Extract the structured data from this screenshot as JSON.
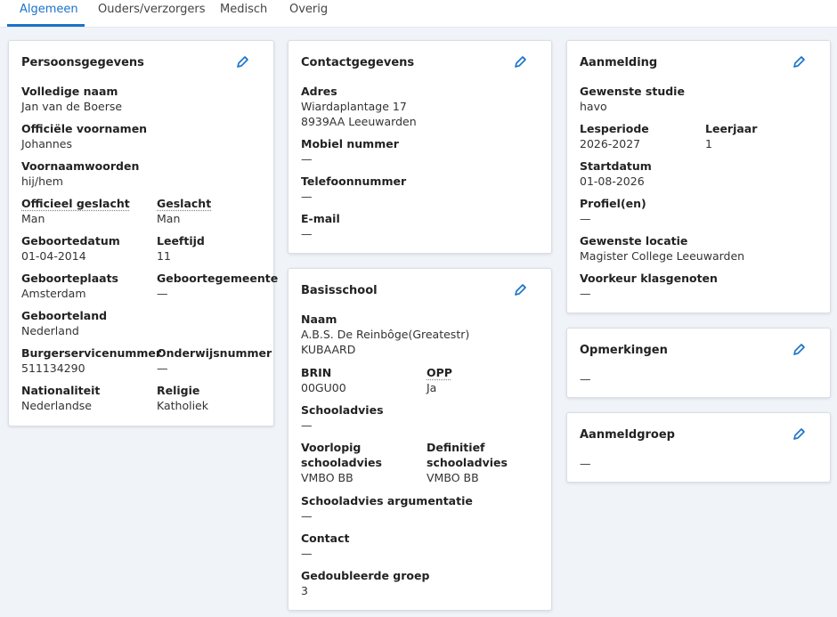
{
  "tabs": [
    "Algemeen",
    "Ouders/verzorgers",
    "Medisch",
    "Overig"
  ],
  "persoon": {
    "title": "Persoonsgegevens",
    "volledige_naam": {
      "label": "Volledige naam",
      "value": "Jan van de Boerse"
    },
    "officiele_voornamen": {
      "label": "Officiële voornamen",
      "value": "Johannes"
    },
    "voornaamwoorden": {
      "label": "Voornaamwoorden",
      "value": "hij/hem"
    },
    "officieel_geslacht": {
      "label": "Officieel geslacht",
      "value": "Man"
    },
    "geslacht": {
      "label": "Geslacht",
      "value": "Man"
    },
    "geboortedatum": {
      "label": "Geboortedatum",
      "value": "01-04-2014"
    },
    "leeftijd": {
      "label": "Leeftijd",
      "value": "11"
    },
    "geboorteplaats": {
      "label": "Geboorteplaats",
      "value": "Amsterdam"
    },
    "geboortegemeente": {
      "label": "Geboortegemeente",
      "value": "—"
    },
    "geboorteland": {
      "label": "Geboorteland",
      "value": "Nederland"
    },
    "bsn": {
      "label": "Burgerservicenummer",
      "value": "511134290"
    },
    "onderwijsnummer": {
      "label": "Onderwijsnummer",
      "value": "—"
    },
    "nationaliteit": {
      "label": "Nationaliteit",
      "value": "Nederlandse"
    },
    "religie": {
      "label": "Religie",
      "value": "Katholiek"
    }
  },
  "contact": {
    "title": "Contactgegevens",
    "adres": {
      "label": "Adres",
      "line1": "Wiardaplantage 17",
      "line2": "8939AA Leeuwarden"
    },
    "mobiel": {
      "label": "Mobiel nummer",
      "value": "—"
    },
    "telefoon": {
      "label": "Telefoonnummer",
      "value": "—"
    },
    "email": {
      "label": "E-mail",
      "value": "—"
    }
  },
  "basisschool": {
    "title": "Basisschool",
    "naam": {
      "label": "Naam",
      "line1": "A.B.S. De Reinbôge(Greatestr)",
      "line2": "KUBAARD"
    },
    "brin": {
      "label": "BRIN",
      "value": "00GU00"
    },
    "opp": {
      "label": "OPP",
      "value": "Ja"
    },
    "schooladvies": {
      "label": "Schooladvies",
      "value": "—"
    },
    "voorlopig": {
      "label1": "Voorlopig",
      "label2": "schooladvies",
      "value": "VMBO BB"
    },
    "definitief": {
      "label1": "Definitief",
      "label2": "schooladvies",
      "value": "VMBO BB"
    },
    "argumentatie": {
      "label": "Schooladvies argumentatie",
      "value": "—"
    },
    "contact": {
      "label": "Contact",
      "value": "—"
    },
    "gedoubleerd": {
      "label": "Gedoubleerde groep",
      "value": "3"
    }
  },
  "aanmelding": {
    "title": "Aanmelding",
    "studie": {
      "label": "Gewenste studie",
      "value": "havo"
    },
    "lesperiode": {
      "label": "Lesperiode",
      "value": "2026-2027"
    },
    "leerjaar": {
      "label": "Leerjaar",
      "value": "1"
    },
    "startdatum": {
      "label": "Startdatum",
      "value": "01-08-2026"
    },
    "profielen": {
      "label": "Profiel(en)",
      "value": "—"
    },
    "locatie": {
      "label": "Gewenste locatie",
      "value": "Magister College Leeuwarden"
    },
    "voorkeur": {
      "label": "Voorkeur klasgenoten",
      "value": "—"
    }
  },
  "opmerkingen": {
    "title": "Opmerkingen",
    "value": "—"
  },
  "aanmeldgroep": {
    "title": "Aanmeldgroep",
    "value": "—"
  },
  "colors": {
    "accent": "#1a73c8",
    "background": "#f0f4f9"
  },
  "icons": {
    "edit": "pencil-icon"
  }
}
